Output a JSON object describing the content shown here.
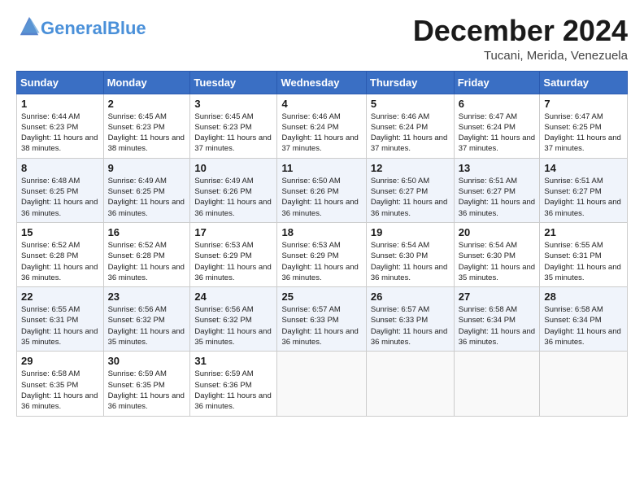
{
  "logo": {
    "text_general": "General",
    "text_blue": "Blue"
  },
  "title": "December 2024",
  "location": "Tucani, Merida, Venezuela",
  "days_of_week": [
    "Sunday",
    "Monday",
    "Tuesday",
    "Wednesday",
    "Thursday",
    "Friday",
    "Saturday"
  ],
  "weeks": [
    [
      {
        "day": 1,
        "sunrise": "6:44 AM",
        "sunset": "6:23 PM",
        "daylight": "11 hours and 38 minutes."
      },
      {
        "day": 2,
        "sunrise": "6:45 AM",
        "sunset": "6:23 PM",
        "daylight": "11 hours and 38 minutes."
      },
      {
        "day": 3,
        "sunrise": "6:45 AM",
        "sunset": "6:23 PM",
        "daylight": "11 hours and 37 minutes."
      },
      {
        "day": 4,
        "sunrise": "6:46 AM",
        "sunset": "6:24 PM",
        "daylight": "11 hours and 37 minutes."
      },
      {
        "day": 5,
        "sunrise": "6:46 AM",
        "sunset": "6:24 PM",
        "daylight": "11 hours and 37 minutes."
      },
      {
        "day": 6,
        "sunrise": "6:47 AM",
        "sunset": "6:24 PM",
        "daylight": "11 hours and 37 minutes."
      },
      {
        "day": 7,
        "sunrise": "6:47 AM",
        "sunset": "6:25 PM",
        "daylight": "11 hours and 37 minutes."
      }
    ],
    [
      {
        "day": 8,
        "sunrise": "6:48 AM",
        "sunset": "6:25 PM",
        "daylight": "11 hours and 36 minutes."
      },
      {
        "day": 9,
        "sunrise": "6:49 AM",
        "sunset": "6:25 PM",
        "daylight": "11 hours and 36 minutes."
      },
      {
        "day": 10,
        "sunrise": "6:49 AM",
        "sunset": "6:26 PM",
        "daylight": "11 hours and 36 minutes."
      },
      {
        "day": 11,
        "sunrise": "6:50 AM",
        "sunset": "6:26 PM",
        "daylight": "11 hours and 36 minutes."
      },
      {
        "day": 12,
        "sunrise": "6:50 AM",
        "sunset": "6:27 PM",
        "daylight": "11 hours and 36 minutes."
      },
      {
        "day": 13,
        "sunrise": "6:51 AM",
        "sunset": "6:27 PM",
        "daylight": "11 hours and 36 minutes."
      },
      {
        "day": 14,
        "sunrise": "6:51 AM",
        "sunset": "6:27 PM",
        "daylight": "11 hours and 36 minutes."
      }
    ],
    [
      {
        "day": 15,
        "sunrise": "6:52 AM",
        "sunset": "6:28 PM",
        "daylight": "11 hours and 36 minutes."
      },
      {
        "day": 16,
        "sunrise": "6:52 AM",
        "sunset": "6:28 PM",
        "daylight": "11 hours and 36 minutes."
      },
      {
        "day": 17,
        "sunrise": "6:53 AM",
        "sunset": "6:29 PM",
        "daylight": "11 hours and 36 minutes."
      },
      {
        "day": 18,
        "sunrise": "6:53 AM",
        "sunset": "6:29 PM",
        "daylight": "11 hours and 36 minutes."
      },
      {
        "day": 19,
        "sunrise": "6:54 AM",
        "sunset": "6:30 PM",
        "daylight": "11 hours and 36 minutes."
      },
      {
        "day": 20,
        "sunrise": "6:54 AM",
        "sunset": "6:30 PM",
        "daylight": "11 hours and 35 minutes."
      },
      {
        "day": 21,
        "sunrise": "6:55 AM",
        "sunset": "6:31 PM",
        "daylight": "11 hours and 35 minutes."
      }
    ],
    [
      {
        "day": 22,
        "sunrise": "6:55 AM",
        "sunset": "6:31 PM",
        "daylight": "11 hours and 35 minutes."
      },
      {
        "day": 23,
        "sunrise": "6:56 AM",
        "sunset": "6:32 PM",
        "daylight": "11 hours and 35 minutes."
      },
      {
        "day": 24,
        "sunrise": "6:56 AM",
        "sunset": "6:32 PM",
        "daylight": "11 hours and 35 minutes."
      },
      {
        "day": 25,
        "sunrise": "6:57 AM",
        "sunset": "6:33 PM",
        "daylight": "11 hours and 36 minutes."
      },
      {
        "day": 26,
        "sunrise": "6:57 AM",
        "sunset": "6:33 PM",
        "daylight": "11 hours and 36 minutes."
      },
      {
        "day": 27,
        "sunrise": "6:58 AM",
        "sunset": "6:34 PM",
        "daylight": "11 hours and 36 minutes."
      },
      {
        "day": 28,
        "sunrise": "6:58 AM",
        "sunset": "6:34 PM",
        "daylight": "11 hours and 36 minutes."
      }
    ],
    [
      {
        "day": 29,
        "sunrise": "6:58 AM",
        "sunset": "6:35 PM",
        "daylight": "11 hours and 36 minutes."
      },
      {
        "day": 30,
        "sunrise": "6:59 AM",
        "sunset": "6:35 PM",
        "daylight": "11 hours and 36 minutes."
      },
      {
        "day": 31,
        "sunrise": "6:59 AM",
        "sunset": "6:36 PM",
        "daylight": "11 hours and 36 minutes."
      },
      null,
      null,
      null,
      null
    ]
  ]
}
